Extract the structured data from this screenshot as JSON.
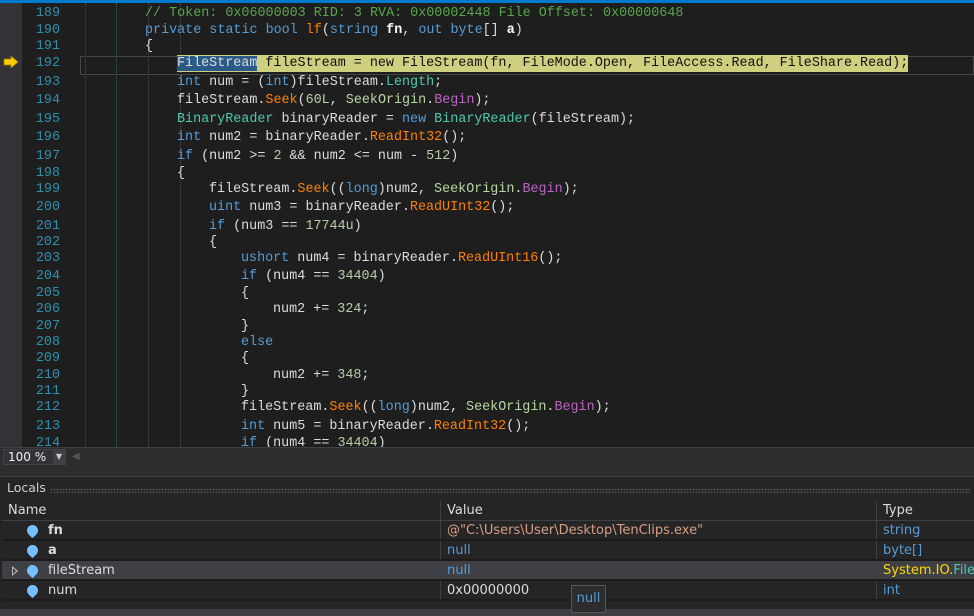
{
  "editor": {
    "current_line": 192,
    "lines": [
      {
        "n": "189",
        "i": 0,
        "t": [
          [
            "c",
            "// Token: 0x06000003 RID: 3 RVA: 0x00002448 File Offset: 0x00000648"
          ]
        ]
      },
      {
        "n": "190",
        "i": 0,
        "t": [
          [
            "k",
            "private"
          ],
          [
            "v",
            " "
          ],
          [
            "k",
            "static"
          ],
          [
            "v",
            " "
          ],
          [
            "k",
            "bool"
          ],
          [
            "v",
            " "
          ],
          [
            "m",
            "lf"
          ],
          [
            "v",
            "("
          ],
          [
            "k",
            "string"
          ],
          [
            "v",
            " "
          ],
          [
            "b",
            "fn"
          ],
          [
            "v",
            ", "
          ],
          [
            "k",
            "out"
          ],
          [
            "v",
            " "
          ],
          [
            "k",
            "byte"
          ],
          [
            "v",
            "[] "
          ],
          [
            "b",
            "a"
          ],
          [
            "v",
            ")"
          ]
        ]
      },
      {
        "n": "191",
        "i": 0,
        "t": [
          [
            "v",
            "{"
          ]
        ]
      },
      {
        "n": "192",
        "i": 1,
        "hl": true,
        "t": [
          [
            "sel",
            "FileStream"
          ],
          [
            "h",
            " fileStream = new FileStream(fn, FileMode.Open, FileAccess.Read, FileShare.Read);"
          ]
        ]
      },
      {
        "n": "193",
        "i": 1,
        "t": [
          [
            "k",
            "int"
          ],
          [
            "v",
            " num = ("
          ],
          [
            "k",
            "int"
          ],
          [
            "v",
            ")fileStream."
          ],
          [
            "t",
            "Length"
          ],
          [
            "v",
            ";"
          ]
        ]
      },
      {
        "n": "194",
        "i": 1,
        "t": [
          [
            "v",
            "fileStream."
          ],
          [
            "m",
            "Seek"
          ],
          [
            "v",
            "("
          ],
          [
            "n",
            "60L"
          ],
          [
            "v",
            ", "
          ],
          [
            "e",
            "SeekOrigin"
          ],
          [
            "v",
            "."
          ],
          [
            "p",
            "Begin"
          ],
          [
            "v",
            ");"
          ]
        ]
      },
      {
        "n": "195",
        "i": 1,
        "t": [
          [
            "t",
            "BinaryReader"
          ],
          [
            "v",
            " binaryReader = "
          ],
          [
            "k",
            "new"
          ],
          [
            "v",
            " "
          ],
          [
            "t",
            "BinaryReader"
          ],
          [
            "v",
            "(fileStream);"
          ]
        ]
      },
      {
        "n": "196",
        "i": 1,
        "t": [
          [
            "k",
            "int"
          ],
          [
            "v",
            " num2 = binaryReader."
          ],
          [
            "m",
            "ReadInt32"
          ],
          [
            "v",
            "();"
          ]
        ]
      },
      {
        "n": "197",
        "i": 1,
        "t": [
          [
            "k",
            "if"
          ],
          [
            "v",
            " (num2 >= "
          ],
          [
            "n",
            "2"
          ],
          [
            "v",
            " && num2 <= num - "
          ],
          [
            "n",
            "512"
          ],
          [
            "v",
            ")"
          ]
        ]
      },
      {
        "n": "198",
        "i": 1,
        "t": [
          [
            "v",
            "{"
          ]
        ]
      },
      {
        "n": "199",
        "i": 2,
        "t": [
          [
            "v",
            "fileStream."
          ],
          [
            "m",
            "Seek"
          ],
          [
            "v",
            "(("
          ],
          [
            "k",
            "long"
          ],
          [
            "v",
            ")num2, "
          ],
          [
            "e",
            "SeekOrigin"
          ],
          [
            "v",
            "."
          ],
          [
            "p",
            "Begin"
          ],
          [
            "v",
            ");"
          ]
        ]
      },
      {
        "n": "200",
        "i": 2,
        "t": [
          [
            "k",
            "uint"
          ],
          [
            "v",
            " num3 = binaryReader."
          ],
          [
            "m",
            "ReadUInt32"
          ],
          [
            "v",
            "();"
          ]
        ]
      },
      {
        "n": "201",
        "i": 2,
        "t": [
          [
            "k",
            "if"
          ],
          [
            "v",
            " (num3 == "
          ],
          [
            "n",
            "17744u"
          ],
          [
            "v",
            ")"
          ]
        ]
      },
      {
        "n": "202",
        "i": 2,
        "t": [
          [
            "v",
            "{"
          ]
        ]
      },
      {
        "n": "203",
        "i": 3,
        "t": [
          [
            "k",
            "ushort"
          ],
          [
            "v",
            " num4 = binaryReader."
          ],
          [
            "m",
            "ReadUInt16"
          ],
          [
            "v",
            "();"
          ]
        ]
      },
      {
        "n": "204",
        "i": 3,
        "t": [
          [
            "k",
            "if"
          ],
          [
            "v",
            " (num4 == "
          ],
          [
            "n",
            "34404"
          ],
          [
            "v",
            ")"
          ]
        ]
      },
      {
        "n": "205",
        "i": 3,
        "t": [
          [
            "v",
            "{"
          ]
        ]
      },
      {
        "n": "206",
        "i": 4,
        "t": [
          [
            "v",
            "num2 += "
          ],
          [
            "n",
            "324"
          ],
          [
            "v",
            ";"
          ]
        ]
      },
      {
        "n": "207",
        "i": 3,
        "t": [
          [
            "v",
            "}"
          ]
        ]
      },
      {
        "n": "208",
        "i": 3,
        "t": [
          [
            "k",
            "else"
          ]
        ]
      },
      {
        "n": "209",
        "i": 3,
        "t": [
          [
            "v",
            "{"
          ]
        ]
      },
      {
        "n": "210",
        "i": 4,
        "t": [
          [
            "v",
            "num2 += "
          ],
          [
            "n",
            "348"
          ],
          [
            "v",
            ";"
          ]
        ]
      },
      {
        "n": "211",
        "i": 3,
        "t": [
          [
            "v",
            "}"
          ]
        ]
      },
      {
        "n": "212",
        "i": 3,
        "t": [
          [
            "v",
            "fileStream."
          ],
          [
            "m",
            "Seek"
          ],
          [
            "v",
            "(("
          ],
          [
            "k",
            "long"
          ],
          [
            "v",
            ")num2, "
          ],
          [
            "e",
            "SeekOrigin"
          ],
          [
            "v",
            "."
          ],
          [
            "p",
            "Begin"
          ],
          [
            "v",
            ");"
          ]
        ]
      },
      {
        "n": "213",
        "i": 3,
        "t": [
          [
            "k",
            "int"
          ],
          [
            "v",
            " num5 = binaryReader."
          ],
          [
            "m",
            "ReadInt32"
          ],
          [
            "v",
            "();"
          ]
        ]
      },
      {
        "n": "214",
        "i": 3,
        "t": [
          [
            "k",
            "if"
          ],
          [
            "v",
            " (num4 == "
          ],
          [
            "n",
            "34404"
          ],
          [
            "v",
            ")"
          ]
        ]
      }
    ]
  },
  "zoom": {
    "value": "100 %"
  },
  "locals": {
    "title": "Locals",
    "headers": {
      "name": "Name",
      "value": "Value",
      "type": "Type"
    },
    "rows": [
      {
        "name": "fn",
        "value": "@\"C:\\Users\\User\\Desktop\\TenClips.exe\"",
        "type": "string"
      },
      {
        "name": "a",
        "value": "null",
        "type": "byte[]"
      },
      {
        "name": "fileStream",
        "value": "null",
        "type_ns": "System.IO.",
        "type_cls": "FileStream"
      },
      {
        "name": "num",
        "value": "0x00000000",
        "type": "int"
      }
    ]
  },
  "tooltip": {
    "text": "null"
  },
  "colors": {
    "accent": "#007acc",
    "line_number": "#2b91af",
    "current_statement": "#cfcf80"
  }
}
